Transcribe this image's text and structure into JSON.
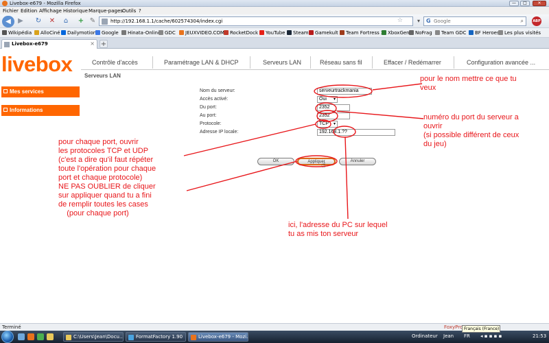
{
  "window": {
    "title": "Livebox-e679 - Mozilla Firefox",
    "buttons": [
      "—",
      "□",
      "✕"
    ]
  },
  "menu": [
    "Fichier",
    "Edition",
    "Affichage",
    "Historique",
    "Marque-pages",
    "Outils",
    "?"
  ],
  "nav": {
    "url": "http://192.168.1.1/cache/602574304/index.cgi",
    "search_placeholder": "Google",
    "search_engine_glyph": "G",
    "abp_label": "ABP"
  },
  "bookmarks": [
    {
      "label": "Wikipédia",
      "color": "#555555"
    },
    {
      "label": "AlloCiné",
      "color": "#d9a21b"
    },
    {
      "label": "Dailymotion",
      "color": "#0066dc"
    },
    {
      "label": "Google",
      "color": "#3b78e7"
    },
    {
      "label": "Hinata-Online",
      "color": "#777777"
    },
    {
      "label": "GDC",
      "color": "#888888"
    },
    {
      "label": "JEUXVIDEO.COM",
      "color": "#e8731d"
    },
    {
      "label": "RocketDock",
      "color": "#c0392b"
    },
    {
      "label": "YouTube",
      "color": "#e62117"
    },
    {
      "label": "Steam",
      "color": "#1b2838"
    },
    {
      "label": "Gamekult",
      "color": "#b71c1c"
    },
    {
      "label": "Team Fortress 2",
      "color": "#9e3b1b"
    },
    {
      "label": "XboxGen",
      "color": "#2e7d32"
    },
    {
      "label": "NoFrag",
      "color": "#666666"
    },
    {
      "label": "Team GDC",
      "color": "#888888"
    },
    {
      "label": "BF Heroes",
      "color": "#1565c0"
    },
    {
      "label": "Les plus visités",
      "color": "#888888"
    }
  ],
  "tab": {
    "label": "Livebox-e679",
    "new_tab": "+",
    "close": "×"
  },
  "page": {
    "logo": "livebox",
    "topnav": [
      "Contrôle d'accès",
      "Paramétrage LAN & DHCP",
      "Serveurs LAN",
      "Réseau sans fil",
      "Effacer / Redémarrer",
      "Configuration avancée ..."
    ],
    "section_title": "Serveurs LAN",
    "sidebar": [
      "Mes services",
      "Informations"
    ],
    "form": {
      "server_name_label": "Nom du serveur:",
      "server_name_value": "serveurtrackmania",
      "access_label": "Accès activé:",
      "access_value": "Oui",
      "port_from_label": "Du port:",
      "port_from_value": "2352",
      "port_to_label": "Au port:",
      "port_to_value": "2352",
      "protocol_label": "Protocole:",
      "protocol_value": "TCP",
      "ip_label": "Adresse IP locale:",
      "ip_value": "192.168.1.??"
    },
    "buttons": {
      "ok": "OK",
      "apply": "Appliquer",
      "cancel": "Annuler"
    }
  },
  "annotations": {
    "name_note": [
      "pour le nom mettre ce que tu",
      "veux"
    ],
    "port_note": [
      "numéro du port du serveur a",
      "ouvrir",
      "(si possible différent de ceux",
      "du jeu)"
    ],
    "protocol_note": [
      "pour chaque port, ouvrir",
      "les protocoles TCP et UDP",
      "(c'est a dire qu'il faut répéter",
      "toute l'opération pour chaque",
      "port et chaque protocole)",
      "NE PAS OUBLIER de cliquer",
      "sur appliquer quand tu a fini",
      "de remplir toutes les cases",
      "    (pour chaque port)"
    ],
    "ip_note": [
      "ici, l'adresse du PC sur lequel",
      "tu as mis ton serveur"
    ],
    "color": "#e8161a"
  },
  "status": {
    "text": "Terminé",
    "foxyproxy": "FoxyProxy",
    "tooltip": "Français (France)"
  },
  "taskbar": {
    "items": [
      {
        "label": "C:\\Users\\Jean\\Docu...",
        "color": "#e8c85a"
      },
      {
        "label": "FormatFactory 1.90",
        "color": "#4aa3df"
      },
      {
        "label": "Livebox-e679 - Mozi...",
        "color": "#e8731d"
      }
    ],
    "tray": {
      "computer": "Ordinateur",
      "user": "Jean",
      "lang": "FR",
      "clock": "21:53"
    }
  }
}
